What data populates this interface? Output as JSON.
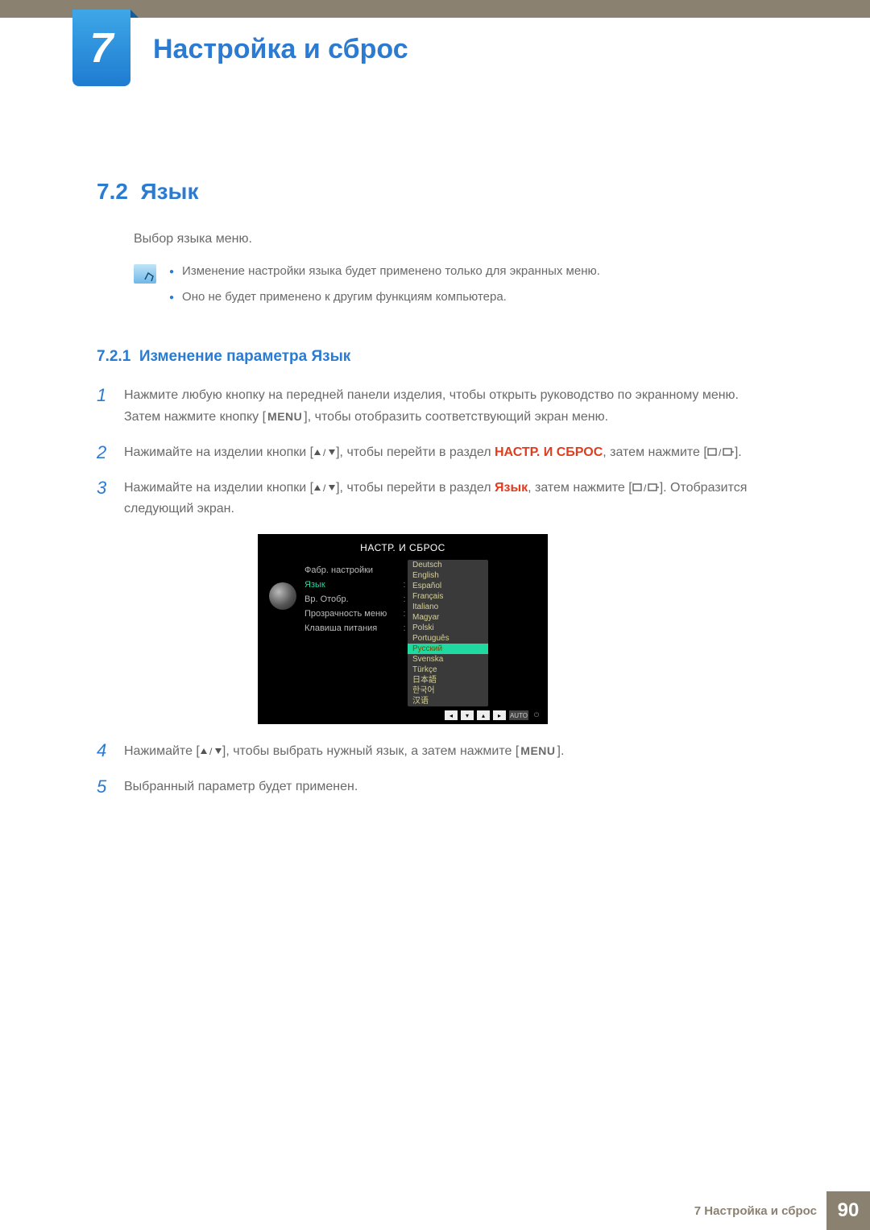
{
  "chapter": {
    "number": "7",
    "title": "Настройка и сброс"
  },
  "section": {
    "number": "7.2",
    "title": "Язык"
  },
  "intro": "Выбор языка меню.",
  "note": {
    "items": [
      "Изменение настройки языка будет применено только для экранных меню.",
      "Оно не будет применено к другим функциям компьютера."
    ]
  },
  "subsection": {
    "number": "7.2.1",
    "title": "Изменение параметра Язык"
  },
  "steps": {
    "s1": {
      "pre": "Нажмите любую кнопку на передней панели изделия, чтобы открыть руководство по экранному меню. Затем нажмите кнопку [",
      "menu": "MENU",
      "post": "], чтобы отобразить соответствующий экран меню."
    },
    "s2": {
      "pre": "Нажимайте на изделии кнопки [",
      "mid": "], чтобы перейти в раздел ",
      "target": "НАСТР. И СБРОС",
      "post1": ", затем нажмите [",
      "post2": "]."
    },
    "s3": {
      "pre": "Нажимайте на изделии кнопки [",
      "mid": "], чтобы перейти в раздел ",
      "target": "Язык",
      "post1": ", затем нажмите [",
      "post2": "]. Отобразится следующий экран."
    },
    "s4": {
      "pre": "Нажимайте [",
      "mid": "], чтобы выбрать нужный язык, а затем нажмите [",
      "menu": "MENU",
      "post": "]."
    },
    "s5": "Выбранный параметр будет применен."
  },
  "osd": {
    "title": "НАСТР. И СБРОС",
    "left_items": [
      "Фабр. настройки",
      "Язык",
      "Вр. Отобр.",
      "Прозрачность меню",
      "Клавиша питания"
    ],
    "selected_left_index": 1,
    "languages": [
      "Deutsch",
      "English",
      "Español",
      "Français",
      "Italiano",
      "Magyar",
      "Polski",
      "Português",
      "Русский",
      "Svenska",
      "Türkçe",
      "日本語",
      "한국어",
      "汉语"
    ],
    "selected_language_index": 8,
    "auto_label": "AUTO"
  },
  "footer": {
    "label": "7 Настройка и сброс",
    "page": "90"
  }
}
